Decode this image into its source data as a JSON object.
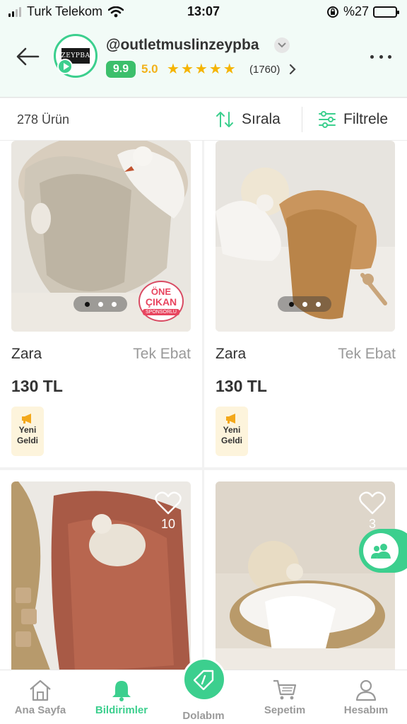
{
  "status_bar": {
    "carrier": "Turk Telekom",
    "time": "13:07",
    "battery": "%27",
    "battery_level": 0.27
  },
  "header": {
    "store_name": "@outletmuslinzeypba",
    "logo_text": "ZEYPBA",
    "score": "9.9",
    "rating": "5.0",
    "stars": 5,
    "rating_count": "(1760)",
    "accent": "#3ccf8e"
  },
  "toolbar": {
    "product_count": "278 Ürün",
    "sort_label": "Sırala",
    "filter_label": "Filtrele"
  },
  "products": [
    {
      "brand": "Zara",
      "size": "Tek Ebat",
      "price": "130 TL",
      "badge_line1": "Yeni",
      "badge_line2": "Geldi",
      "sponsor_line1": "ÖNE",
      "sponsor_line2": "ÇIKAN",
      "sponsor_line3": "SPONSORLU"
    },
    {
      "brand": "Zara",
      "size": "Tek Ebat",
      "price": "130 TL",
      "badge_line1": "Yeni",
      "badge_line2": "Geldi"
    },
    {
      "likes": "10"
    },
    {
      "likes": "3"
    }
  ],
  "bottom_nav": {
    "home": "Ana Sayfa",
    "notifications": "Bildirimler",
    "closet": "Dolabım",
    "cart": "Sepetim",
    "account": "Hesabım"
  }
}
